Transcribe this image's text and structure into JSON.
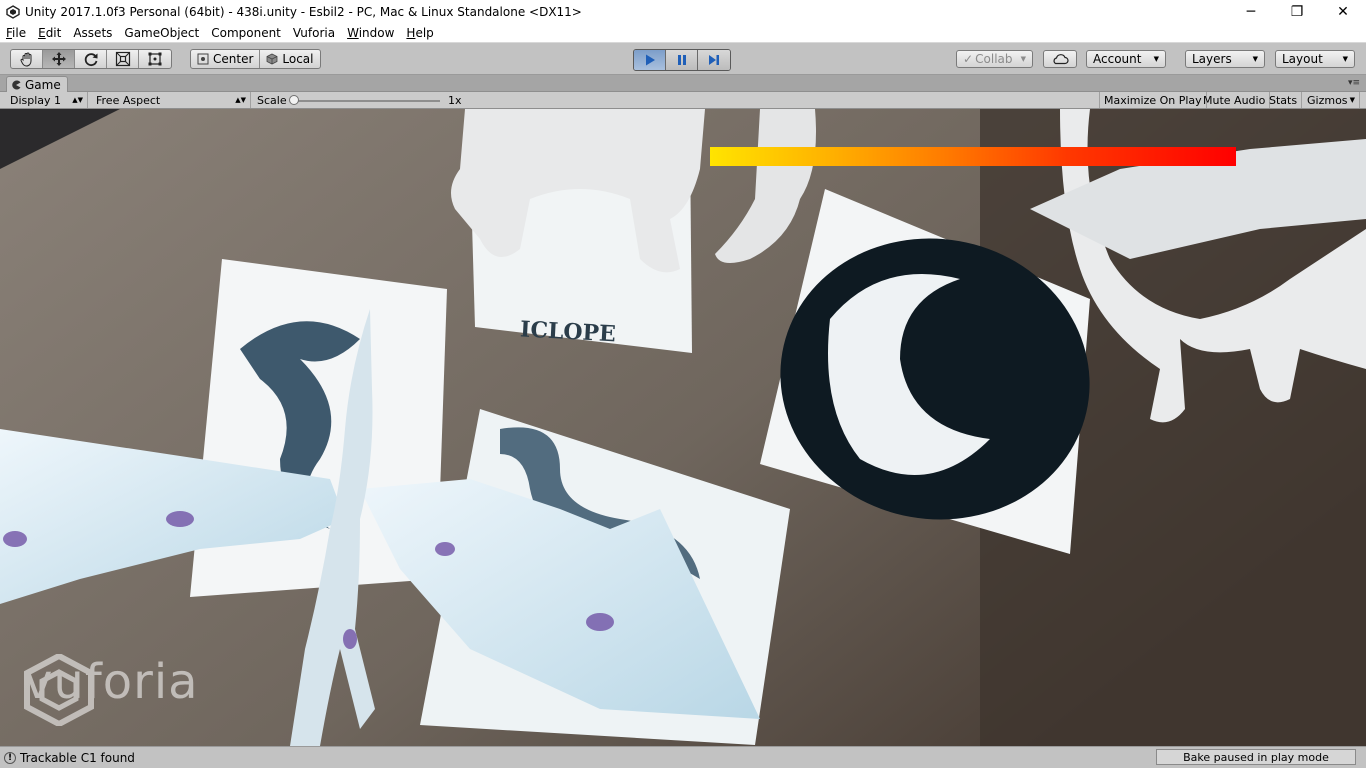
{
  "window": {
    "title": "Unity 2017.1.0f3 Personal (64bit) - 438i.unity - Esbil2 - PC, Mac & Linux Standalone <DX11>",
    "minimize": "─",
    "maximize": "❐",
    "close": "✕"
  },
  "menu": [
    {
      "label": "File",
      "underline": "F",
      "rest": "ile"
    },
    {
      "label": "Edit",
      "underline": "E",
      "rest": "dit"
    },
    {
      "label": "Assets",
      "underline": "",
      "rest": "Assets"
    },
    {
      "label": "GameObject",
      "underline": "",
      "rest": "GameObject"
    },
    {
      "label": "Component",
      "underline": "",
      "rest": "Component"
    },
    {
      "label": "Vuforia",
      "underline": "",
      "rest": "Vuforia"
    },
    {
      "label": "Window",
      "underline": "W",
      "rest": "indow"
    },
    {
      "label": "Help",
      "underline": "H",
      "rest": "elp"
    }
  ],
  "toolbar": {
    "transform_tools": [
      "hand-icon",
      "move-icon",
      "rotate-icon",
      "scale-icon",
      "rect-icon"
    ],
    "center_label": "Center",
    "local_label": "Local",
    "collab_label": "Collab",
    "account_label": "Account",
    "layers_label": "Layers",
    "layout_label": "Layout"
  },
  "game_tab": {
    "label": "Game"
  },
  "game_view_bar": {
    "display": "Display 1",
    "aspect": "Free Aspect",
    "scale_label": "Scale",
    "scale_value": "1x",
    "maximize_on_play": "Maximize On Play",
    "mute_audio": "Mute Audio",
    "stats": "Stats",
    "gizmos": "Gizmos"
  },
  "viewport": {
    "watermark": "vuforia",
    "card_text": "ICLOPE"
  },
  "status": {
    "message": "Trackable C1 found",
    "bake": "Bake paused in play mode"
  },
  "colors": {
    "health_start": "#ffe400",
    "health_end": "#ff0000",
    "play_active": "#7d9ec9"
  }
}
